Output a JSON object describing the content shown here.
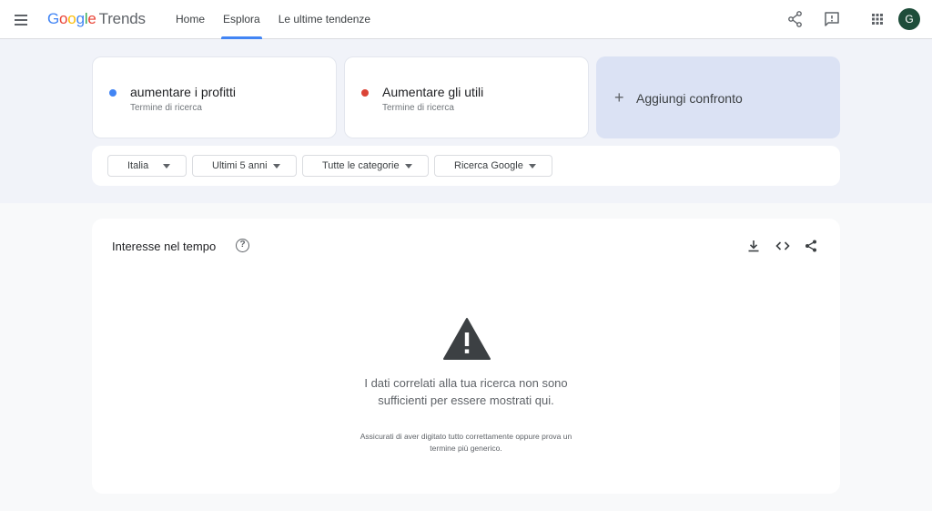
{
  "header": {
    "logo_google": [
      "G",
      "o",
      "o",
      "g",
      "l",
      "e"
    ],
    "logo_trends": "Trends",
    "nav": [
      "Home",
      "Esplora",
      "Le ultime tendenze"
    ],
    "avatar_letter": "G",
    "icons": [
      "menu-icon",
      "share-icon",
      "feedback-icon",
      "apps-icon"
    ]
  },
  "terms": [
    {
      "title": "aumentare i profitti",
      "subtitle": "Termine di ricerca",
      "color": "#4285f4"
    },
    {
      "title": "Aumentare gli utili",
      "subtitle": "Termine di ricerca",
      "color": "#db4437"
    }
  ],
  "add_compare": {
    "icon": "plus-icon",
    "label": "Aggiungi confronto"
  },
  "filters": [
    "Italia",
    "Ultimi 5 anni",
    "Tutte le categorie",
    "Ricerca Google"
  ],
  "interest": {
    "title": "Interesse nel tempo",
    "help_glyph": "?",
    "icons": [
      "help-icon",
      "download-icon",
      "embed-icon",
      "share-icon",
      "warning-icon"
    ],
    "message": "I dati correlati alla tua ricerca non sono sufficienti per essere mostrati qui.",
    "hint": "Assicurati di aver digitato tutto correttamente oppure prova un termine più generico."
  },
  "colors": {
    "accent": "#4285f4",
    "add_card_bg": "#dbe2f4",
    "page_bg": "#f1f3f9"
  }
}
